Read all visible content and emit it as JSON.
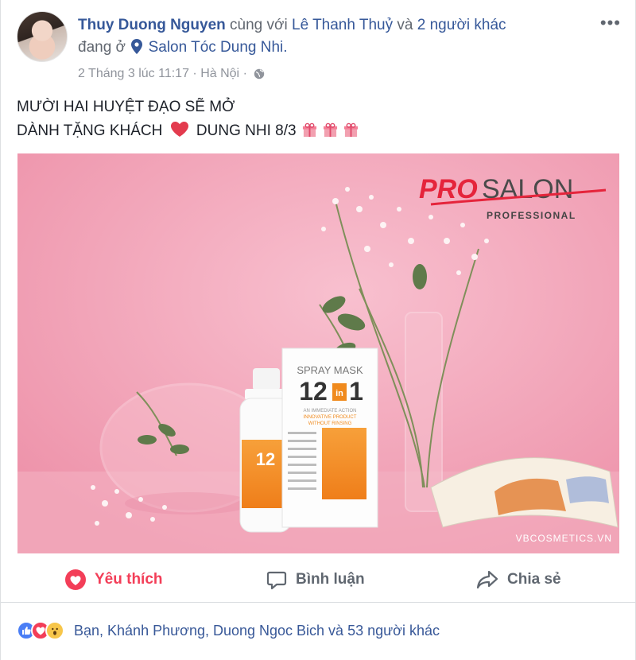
{
  "post": {
    "author": "Thuy Duong Nguyen",
    "with_word": "cùng với",
    "tagged_person": "Lê Thanh Thuỷ",
    "and_word": "và",
    "others": "2 người khác",
    "at_word": "đang ở",
    "location": "Salon Tóc Dung Nhi.",
    "date": "2 Tháng 3 lúc 11:17",
    "place": "Hà Nội",
    "separator": "·",
    "more_label": "•••",
    "text_line1": "MƯỜI HAI HUYỆT ĐẠO SẼ MỞ",
    "text_line2_a": "DÀNH TẶNG KHÁCH",
    "text_line2_b": "DUNG NHI 8/3"
  },
  "photo": {
    "brand_pro": "PRO",
    "brand_salon": "SALON",
    "brand_sub": "PROFESSIONAL",
    "box_title": "SPRAY MASK",
    "box_number": "12",
    "box_in": "in",
    "box_one": "1",
    "box_tag1": "AN IMMEDIATE ACTION",
    "box_tag2": "INNOVATIVE PRODUCT",
    "box_tag3": "WITHOUT RINSING",
    "watermark": "VBCOSMETICS.VN"
  },
  "actions": {
    "like": "Yêu thích",
    "comment": "Bình luận",
    "share": "Chia sẻ"
  },
  "reactions": {
    "summary": "Bạn, Khánh Phương, Duong Ngoc Bich và 53 người khác"
  },
  "colors": {
    "link": "#365899",
    "love": "#f33e58",
    "photo_bg": "#f09fb5"
  }
}
